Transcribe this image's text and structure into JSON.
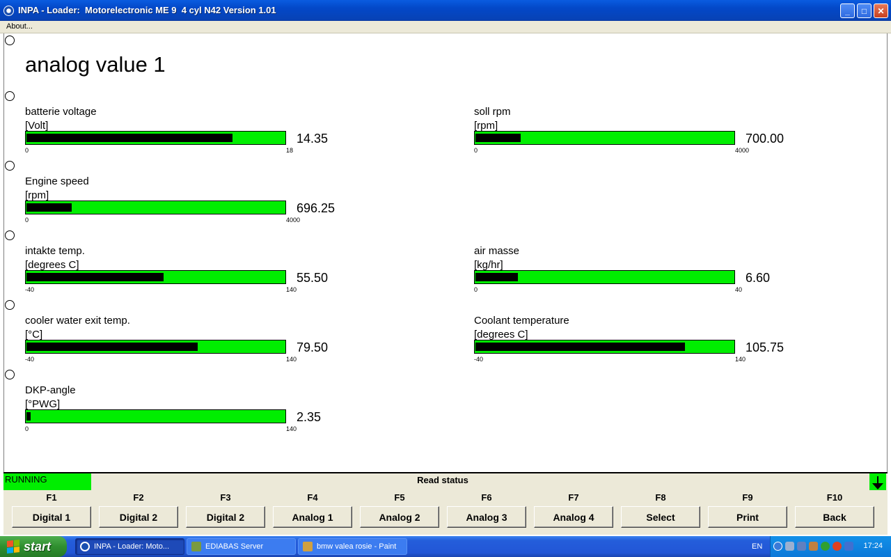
{
  "window": {
    "title": "INPA - Loader:  Motorelectronic ME 9  4 cyl N42 Version 1.01"
  },
  "menu": {
    "about": "About..."
  },
  "page_title": "analog value 1",
  "gauges": [
    {
      "label": "batterie voltage",
      "unit": "[Volt]",
      "min": "0",
      "max": "18",
      "value": "14.35",
      "fraction": 0.797
    },
    {
      "label": "soll rpm",
      "unit": "[rpm]",
      "min": "0",
      "max": "4000",
      "value": "700.00",
      "fraction": 0.175
    },
    {
      "label": "Engine speed",
      "unit": "[rpm]",
      "min": "0",
      "max": "4000",
      "value": "696.25",
      "fraction": 0.174
    },
    {
      "label": "intakte temp.",
      "unit": "[degrees C]",
      "min": "-40",
      "max": "140",
      "value": "55.50",
      "fraction": 0.531
    },
    {
      "label": "air masse",
      "unit": "[kg/hr]",
      "min": "0",
      "max": "40",
      "value": "6.60",
      "fraction": 0.165
    },
    {
      "label": "cooler water exit temp.",
      "unit": "[°C]",
      "min": "-40",
      "max": "140",
      "value": "79.50",
      "fraction": 0.664
    },
    {
      "label": "Coolant temperature",
      "unit": "[degrees C]",
      "min": "-40",
      "max": "140",
      "value": "105.75",
      "fraction": 0.81
    },
    {
      "label": "DKP-angle",
      "unit": "[°PWG]",
      "min": "0",
      "max": "140",
      "value": "2.35",
      "fraction": 0.017
    }
  ],
  "status": {
    "running": "RUNNING",
    "read_status": "Read status"
  },
  "fkeys": [
    {
      "key": "F1",
      "label": "Digital 1"
    },
    {
      "key": "F2",
      "label": "Digital 2"
    },
    {
      "key": "F3",
      "label": "Digital 2"
    },
    {
      "key": "F4",
      "label": "Analog 1"
    },
    {
      "key": "F5",
      "label": "Analog 2"
    },
    {
      "key": "F6",
      "label": "Analog 3"
    },
    {
      "key": "F7",
      "label": "Analog 4"
    },
    {
      "key": "F8",
      "label": "Select"
    },
    {
      "key": "F9",
      "label": "Print"
    },
    {
      "key": "F10",
      "label": "Back"
    }
  ],
  "taskbar": {
    "start": "start",
    "tasks": [
      {
        "label": "INPA - Loader:  Moto...",
        "icon": "bmw-icon",
        "color": "#1a4fb0"
      },
      {
        "label": "EDIABAS Server",
        "icon": "server-icon",
        "color": "#7a9a40"
      },
      {
        "label": "bmw valea rosie - Paint",
        "icon": "paint-icon",
        "color": "#d0a040"
      }
    ],
    "lang": "EN",
    "clock": "17:24"
  },
  "colors": {
    "bar_green": "#00ee00",
    "titlebar": "#0348c8",
    "panel": "#ece9d8"
  }
}
